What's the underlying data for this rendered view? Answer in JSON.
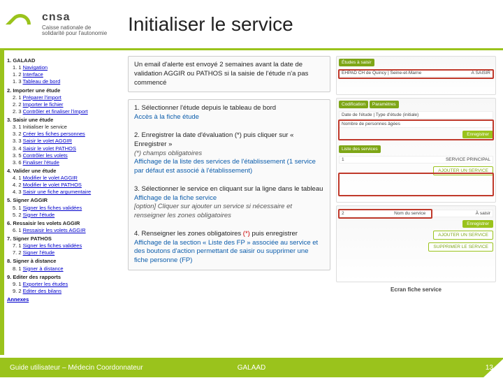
{
  "brand": {
    "name": "cnsa",
    "tagline1": "Caisse nationale de",
    "tagline2": "solidarité pour l'autonomie"
  },
  "title": "Initialiser le service",
  "toc": [
    {
      "type": "section",
      "idx": "1.",
      "label": "GALAAD"
    },
    {
      "type": "item",
      "idx": "1. 1",
      "label": "Navigation",
      "link": true
    },
    {
      "type": "item",
      "idx": "1. 2",
      "label": "Interface",
      "link": true
    },
    {
      "type": "item",
      "idx": "1. 3",
      "label": "Tableau de bord",
      "link": true
    },
    {
      "type": "section",
      "idx": "2.",
      "label": "Importer une étude"
    },
    {
      "type": "item",
      "idx": "2. 1",
      "label": "Préparer l'import",
      "link": true
    },
    {
      "type": "item",
      "idx": "2. 2",
      "label": "Importer le fichier",
      "link": true
    },
    {
      "type": "item",
      "idx": "2. 3",
      "label": "Contrôler et finaliser l'import",
      "link": true
    },
    {
      "type": "section",
      "idx": "3.",
      "label": "Saisir une étude"
    },
    {
      "type": "item",
      "idx": "3. 1",
      "label": "Initialiser le service"
    },
    {
      "type": "item",
      "idx": "3. 2",
      "label": "Créer les fiches personnes",
      "link": true
    },
    {
      "type": "item",
      "idx": "3. 3",
      "label": "Saisir le volet AGGIR",
      "link": true
    },
    {
      "type": "item",
      "idx": "3. 4",
      "label": "Saisir le volet PATHOS",
      "link": true
    },
    {
      "type": "item",
      "idx": "3. 5",
      "label": "Contrôler les volets",
      "link": true
    },
    {
      "type": "item",
      "idx": "3. 6",
      "label": "Finaliser l'étude",
      "link": true
    },
    {
      "type": "section",
      "idx": "4.",
      "label": "Valider une étude"
    },
    {
      "type": "item",
      "idx": "4. 1",
      "label": "Modifier le volet AGGIR",
      "link": true
    },
    {
      "type": "item",
      "idx": "4. 2",
      "label": "Modifier le volet PATHOS",
      "link": true
    },
    {
      "type": "item",
      "idx": "4. 3",
      "label": "Saisir une fiche argumentaire",
      "link": true
    },
    {
      "type": "section",
      "idx": "5.",
      "label": "Signer AGGIR"
    },
    {
      "type": "item",
      "idx": "5. 1",
      "label": "Signer les fiches validées",
      "link": true
    },
    {
      "type": "item",
      "idx": "5. 2",
      "label": "Signer l'étude",
      "link": true
    },
    {
      "type": "section",
      "idx": "6.",
      "label": "Ressaisir les volets AGGIR"
    },
    {
      "type": "item",
      "idx": "6. 1",
      "label": "Ressaisir les volets AGGIR",
      "link": true
    },
    {
      "type": "section",
      "idx": "7.",
      "label": "Signer PATHOS"
    },
    {
      "type": "item",
      "idx": "7. 1",
      "label": "Signer les fiches validées",
      "link": true
    },
    {
      "type": "item",
      "idx": "7. 2",
      "label": "Signer l'étude",
      "link": true
    },
    {
      "type": "section",
      "idx": "8.",
      "label": "Signer à distance"
    },
    {
      "type": "item",
      "idx": "8. 1",
      "label": "Signer à distance",
      "link": true
    },
    {
      "type": "section",
      "idx": "9.",
      "label": "Editer des rapports"
    },
    {
      "type": "item",
      "idx": "9. 1",
      "label": "Exporter les études",
      "link": true
    },
    {
      "type": "item",
      "idx": "9. 2",
      "label": "Editer des bilans",
      "link": true
    },
    {
      "type": "section",
      "idx": "",
      "label": "Annexes",
      "link": true
    }
  ],
  "alert": "Un email d'alerte est envoyé 2 semaines avant la date de validation AGGIR ou PATHOS si la saisie de l'étude n'a pas commencé",
  "steps": {
    "s1_line1": "1. Sélectionner l'étude depuis le tableau de bord",
    "s1_line2": "Accès à la fiche étude",
    "s2_line1": "2. Enregistrer la date d'évaluation (*) puis cliquer sur « Enregistrer »",
    "s2_note": "(*) champs obligatoires",
    "s2_sub1": "Affichage de la liste des services de l'établissement (1 service par défaut est associé à l'établissement)",
    "s3_line1": "3. Sélectionner le service en cliquant sur la ligne dans le tableau",
    "s3_sub1": "Affichage de la fiche service",
    "s3_sub2": "[option] Cliquer sur ajouter un service si nécessaire et renseigner les zones obligatoires",
    "s4_line1": "4. Renseigner les zones obligatoires (*) puis enregistrer",
    "s4_sub1": "Affichage de la section « Liste des FP » associée au service et des boutons d'action permettant de saisir ou supprimer une fiche personne (FP)"
  },
  "right": {
    "shot1": {
      "band": "Études à saisir",
      "row_left": "EHPAD CH de Quincy | Seine-et-Marne",
      "row_right": "À SAISIR"
    },
    "shot2": {
      "band1": "Codification",
      "band2": "Paramètres",
      "row1_l": "Date de l'étude | Type d'étude (initiale)",
      "row2_l": "Nombre de personnes âgées",
      "btn": "Enregistrer",
      "sec": "Liste des services",
      "row3_l": "1",
      "row3_r": "SERVICE PRINCIPAL",
      "btn2": "AJOUTER UN SERVICE"
    },
    "shot3": {
      "btn1": "Enregistrer",
      "btn2": "AJOUTER UN SERVICE",
      "btn3": "SUPPRIMER LE SERVICE",
      "row_n": "2",
      "row_t": "Nom du service",
      "row_st": "À saisir"
    },
    "caption": "Ecran fiche service"
  },
  "footer": {
    "left": "Guide utilisateur – Médecin Coordonnateur",
    "center": "GALAAD",
    "page": "13"
  }
}
